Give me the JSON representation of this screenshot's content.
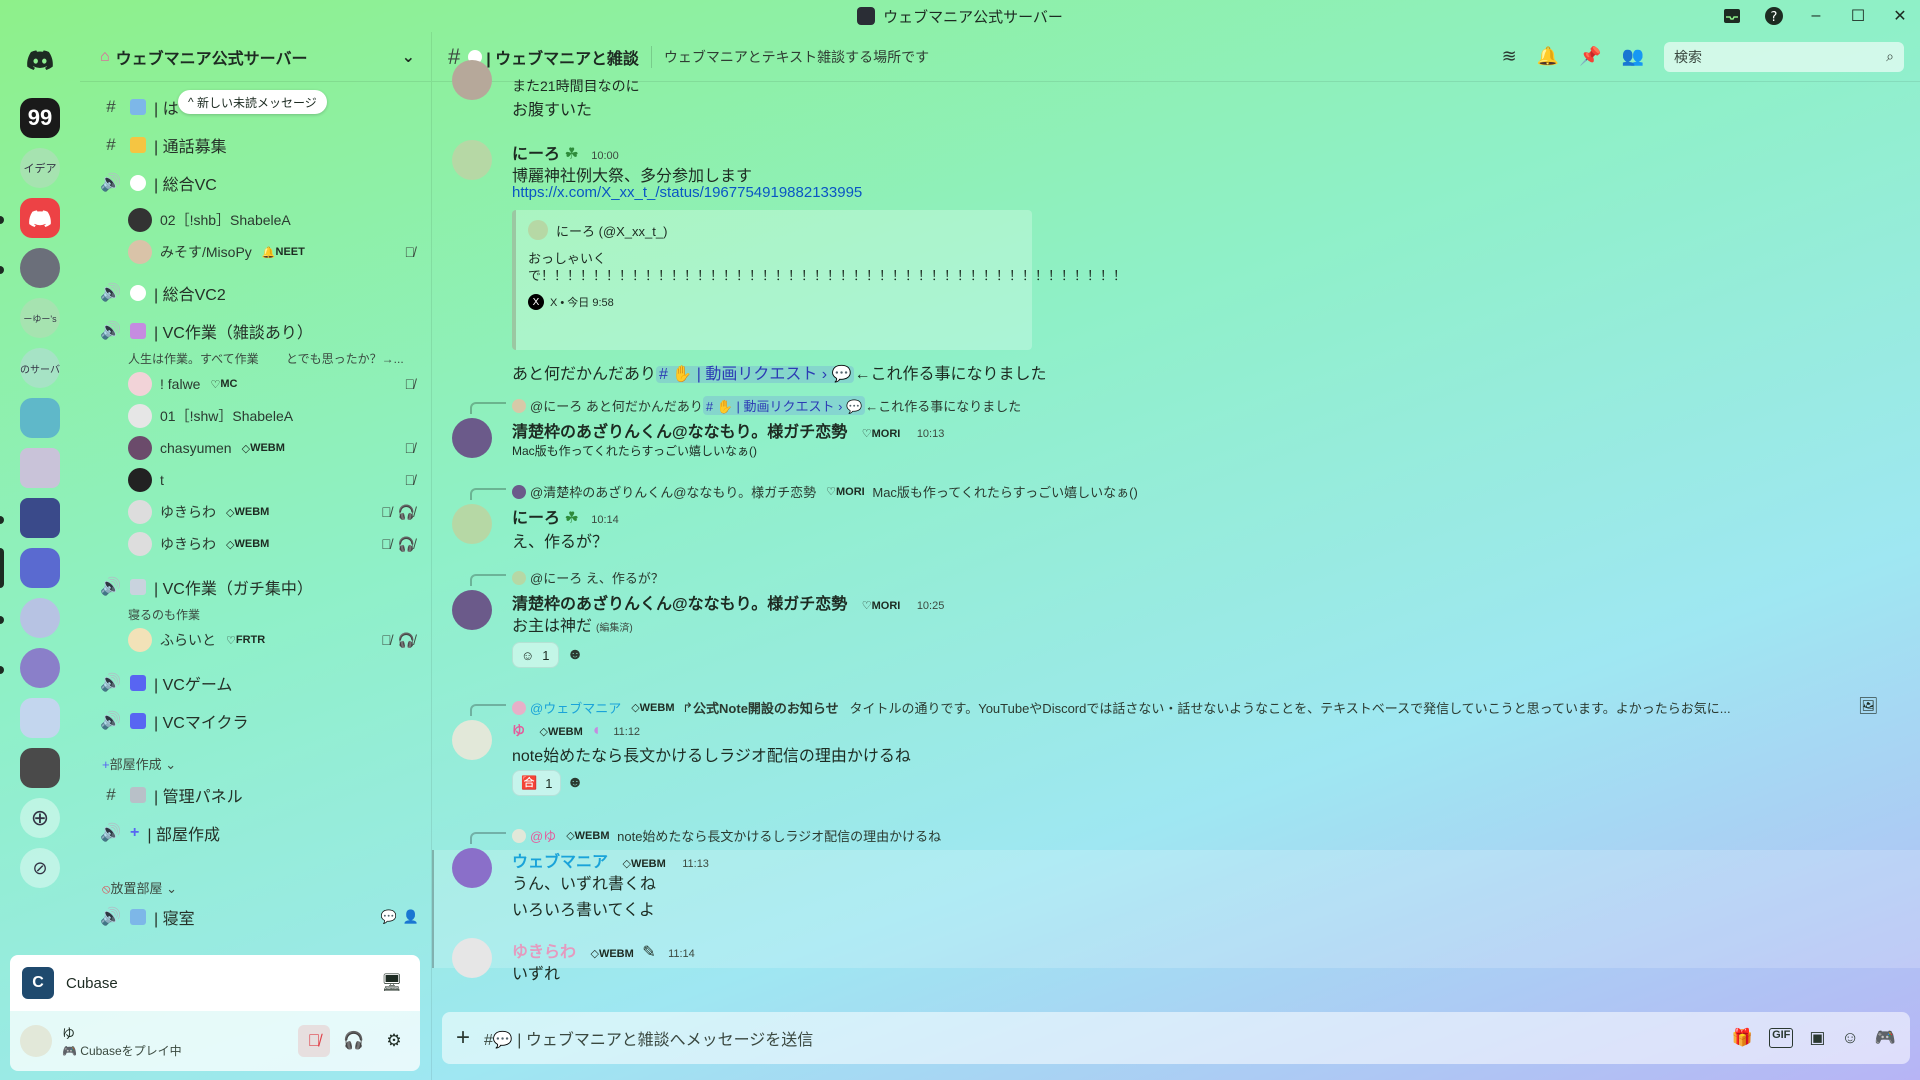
{
  "window": {
    "title": "ウェブマニア公式サーバー"
  },
  "guilds": [
    {
      "name": "discord-home",
      "label": ""
    },
    {
      "name": "quote-server",
      "label": "99"
    },
    {
      "name": "idea-server",
      "label": "イデア"
    },
    {
      "name": "discord-server",
      "label": ""
    },
    {
      "name": "server-5",
      "label": ""
    },
    {
      "name": "server-6",
      "label": "ーゆー's"
    },
    {
      "name": "server-7",
      "label": "のサーバ"
    }
  ],
  "server": {
    "name": "ウェブマニア公式サーバー",
    "unread_pill": "新しい未読メッセージ"
  },
  "channels": {
    "ch1": "| は",
    "ch2": "| 通話募集",
    "vc1": "| 総合VC",
    "vc1_members": [
      {
        "name": "02［!shb］ShabeleA",
        "tag": ""
      },
      {
        "name": "みそす/MisoPy",
        "tag": "NEET"
      }
    ],
    "vc2": "| 総合VC2",
    "vc3": "| VC作業（雑談あり）",
    "vc3_status": "人生は作業。すべて作業 　　とでも思ったか？→...",
    "vc3_members": [
      {
        "name": "! falwe",
        "tag": "MC"
      },
      {
        "name": "01［!shw］ShabeleA",
        "tag": ""
      },
      {
        "name": "chasyumen",
        "tag": "WEBM"
      },
      {
        "name": "t",
        "tag": ""
      },
      {
        "name": "ゆきらわ",
        "tag": "WEBM"
      },
      {
        "name": "ゆきらわ",
        "tag": "WEBM"
      }
    ],
    "vc4": "| VC作業（ガチ集中）",
    "vc4_status": "寝るのも作業",
    "vc4_members": [
      {
        "name": "ふらいと",
        "tag": "FRTR"
      }
    ],
    "vc5": "| VCゲーム",
    "vc6": "| VCマイクラ",
    "cat_create": "部屋作成",
    "admin": "| 管理パネル",
    "create_room": "| 部屋作成",
    "cat_idle": "放置部屋",
    "bedroom": "| 寝室"
  },
  "activity": {
    "app_name": "Cubase"
  },
  "user": {
    "name": "ゆ",
    "status": "Cubaseをプレイ中"
  },
  "channel_header": {
    "name": "| ウェブマニアと雑談",
    "topic": "ウェブマニアとテキスト雑談する場所です",
    "search_placeholder": "検索"
  },
  "messages": {
    "m0_line1": "また21時間目なのに",
    "m0_line2": "お腹すいた",
    "m1_author": "にーろ",
    "m1_time": "10:00",
    "m1_line1": "博麗神社例大祭、多分参加します",
    "m1_link": "https://x.com/X_xx_t_/status/1967754919882133995",
    "embed_author": "にーろ (@X_xx_t_)",
    "embed_text": "おっしゃいく\nで！！！！！！！！！！！！！！！！！！！！！！！！！！！！！！！！！！！！！！！！！！！！！",
    "embed_footer": "X • 今日 9:58",
    "m1_line3_pre": "あと何だかんだあり",
    "m1_line3_mention": "# ✋ | 動画リクエスト › 💬",
    "m1_line3_post": "←これ作る事になりました",
    "m2_reply_author": "@にーろ",
    "m2_reply_pre": "あと何だかんだあり",
    "m2_reply_mention": "# ✋ | 動画リクエスト › 💬",
    "m2_reply_post": "←これ作る事になりました",
    "m2_author": "清楚枠のあざりんくん@ななもり。様ガチ恋勢",
    "m2_tag": "MORI",
    "m2_time": "10:13",
    "m2_line1": "Mac版も作ってくれたらすっごい嬉しいなぁ()",
    "m3_reply_author": "@清楚枠のあざりんくん@ななもり。様ガチ恋勢",
    "m3_reply_tag": "MORI",
    "m3_reply_text": "Mac版も作ってくれたらすっごい嬉しいなぁ()",
    "m3_author": "にーろ",
    "m3_time": "10:14",
    "m3_line1": "え、作るが？",
    "m4_reply_author": "@にーろ",
    "m4_reply_text": "え、作るが？",
    "m4_author": "清楚枠のあざりんくん@ななもり。様ガチ恋勢",
    "m4_tag": "MORI",
    "m4_time": "10:25",
    "m4_line1": "お主は神だ",
    "m4_edited": "(編集済)",
    "m4_reaction_count": "1",
    "m5_reply_author": "@ウェブマニア",
    "m5_reply_tag": "WEBM",
    "m5_reply_title": "公式Note開設のお知らせ",
    "m5_reply_text": "タイトルの通りです。YouTubeやDiscordでは話さない・話せないようなことを、テキストベースで発信していこうと思っています。よかったらお気に...",
    "m5_author": "ゆ",
    "m5_tag": "WEBM",
    "m5_time": "11:12",
    "m5_line1": "note始めたなら長文かけるしラジオ配信の理由かけるね",
    "m5_reaction_count": "1",
    "m6_reply_author": "@ゆ",
    "m6_reply_tag": "WEBM",
    "m6_reply_text": "note始めたなら長文かけるしラジオ配信の理由かけるね",
    "m6_author": "ウェブマニア",
    "m6_tag": "WEBM",
    "m6_time": "11:13",
    "m6_line1": "うん、いずれ書くね",
    "m6_line2": "いろいろ書いてくよ",
    "m7_author": "ゆきらわ",
    "m7_tag": "WEBM",
    "m7_time": "11:14",
    "m7_line1": "いずれ"
  },
  "composer": {
    "placeholder": "#💬 | ウェブマニアと雑談へメッセージを送信"
  },
  "colors": {
    "link": "#0a55c4",
    "mention_bg": "#d6dafb",
    "author_webmania": "#1aa3d9",
    "author_yukirawa": "#e59abf",
    "muted_red": "#e0434b"
  }
}
